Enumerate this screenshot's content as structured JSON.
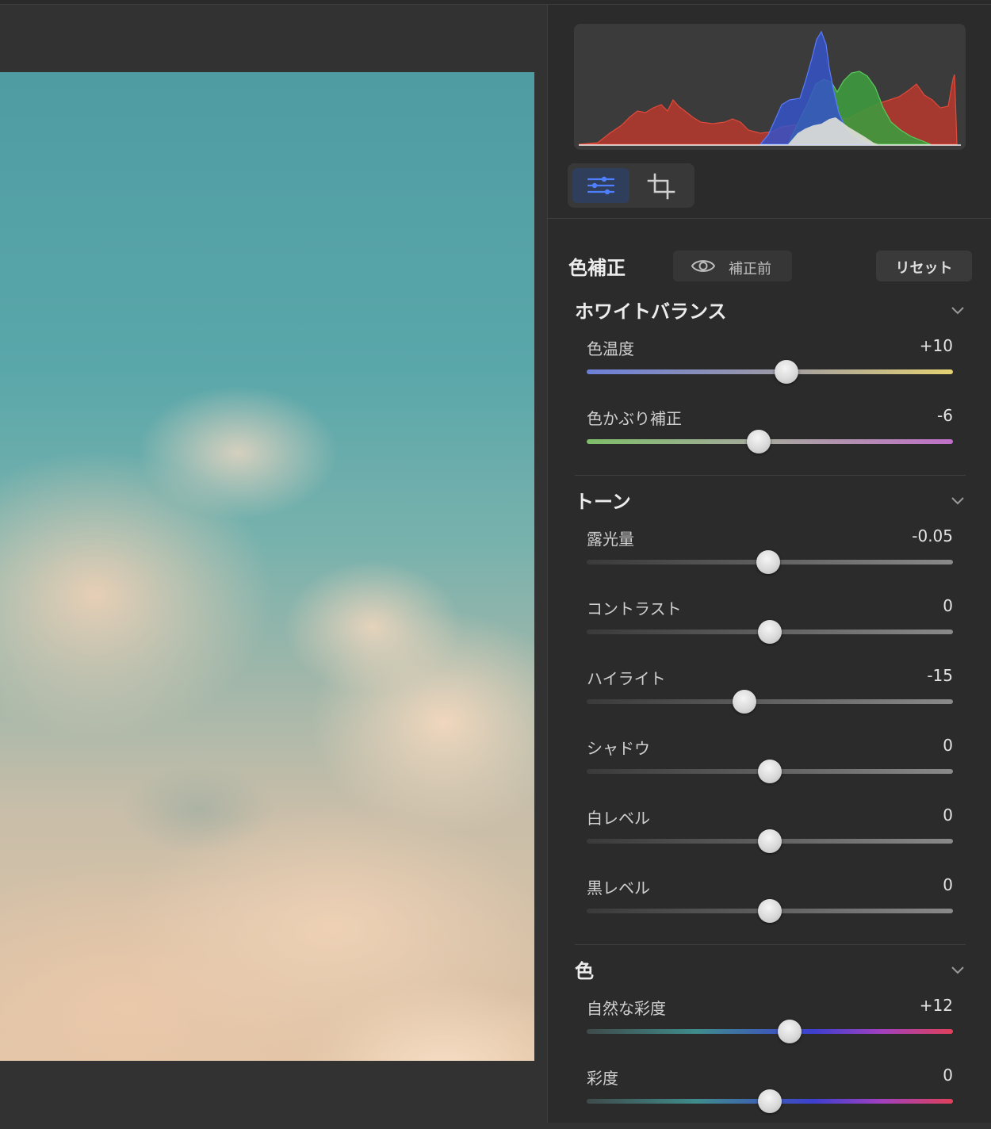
{
  "panel": {
    "title": "色補正",
    "before_label": "補正前",
    "reset_label": "リセット"
  },
  "toolbar": {
    "adjust_icon": "sliders-icon",
    "crop_icon": "crop-icon"
  },
  "sections": {
    "white_balance": {
      "title": "ホワイトバランス",
      "sliders": [
        {
          "label": "色温度",
          "value": "+10",
          "pos": 0.545
        },
        {
          "label": "色かぶり補正",
          "value": "-6",
          "pos": 0.47
        }
      ]
    },
    "tone": {
      "title": "トーン",
      "sliders": [
        {
          "label": "露光量",
          "value": "-0.05",
          "pos": 0.495
        },
        {
          "label": "コントラスト",
          "value": "0",
          "pos": 0.5
        },
        {
          "label": "ハイライト",
          "value": "-15",
          "pos": 0.43
        },
        {
          "label": "シャドウ",
          "value": "0",
          "pos": 0.5
        },
        {
          "label": "白レベル",
          "value": "0",
          "pos": 0.5
        },
        {
          "label": "黒レベル",
          "value": "0",
          "pos": 0.5
        }
      ]
    },
    "color": {
      "title": "色",
      "sliders": [
        {
          "label": "自然な彩度",
          "value": "+12",
          "pos": 0.555
        },
        {
          "label": "彩度",
          "value": "0",
          "pos": 0.5
        }
      ]
    }
  },
  "colors": {
    "histogram_red": "#c0392b",
    "histogram_green": "#3faa3f",
    "histogram_blue": "#3d5cd6",
    "active_tool": "#2f3e5a"
  }
}
